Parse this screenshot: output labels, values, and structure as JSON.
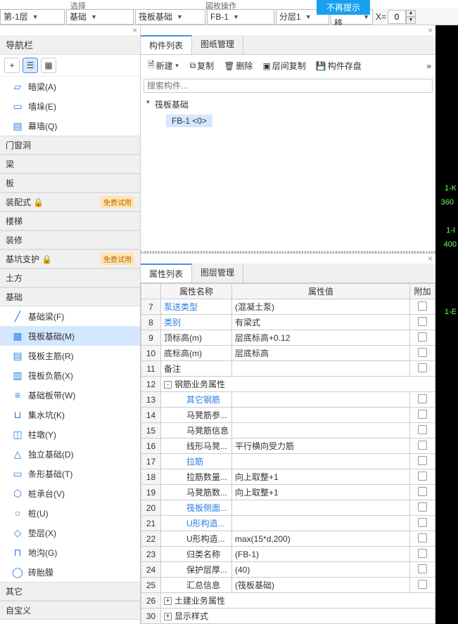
{
  "banner": "不再提示",
  "topbar_labels": {
    "l1": "选择",
    "l2": "図枚操作"
  },
  "toolbar": {
    "floor": "第-1层",
    "cat": "基础",
    "subcat": "筏板基础",
    "item": "FB-1",
    "layer": "分层1",
    "offset": "不偏移",
    "xlabel": "X=",
    "xval": "0"
  },
  "nav": {
    "title": "导航栏",
    "items_top": [
      {
        "icon": "▱",
        "label": "暗梁(A)"
      },
      {
        "icon": "▭",
        "label": "墙垛(E)"
      },
      {
        "icon": "▤",
        "label": "幕墙(Q)"
      }
    ],
    "sections": [
      {
        "title": "门窗洞"
      },
      {
        "title": "梁"
      },
      {
        "title": "板"
      },
      {
        "title": "装配式",
        "locked": true,
        "badge": "免费试用"
      },
      {
        "title": "楼梯"
      },
      {
        "title": "装修"
      },
      {
        "title": "基坑支护",
        "locked": true,
        "badge": "免费试用"
      },
      {
        "title": "土方"
      },
      {
        "title": "基础",
        "expanded": true,
        "items": [
          {
            "icon": "╱",
            "label": "基础梁(F)"
          },
          {
            "icon": "▦",
            "label": "筏板基础(M)",
            "active": true
          },
          {
            "icon": "▤",
            "label": "筏板主筋(R)"
          },
          {
            "icon": "▥",
            "label": "筏板负筋(X)"
          },
          {
            "icon": "≡",
            "label": "基础板带(W)"
          },
          {
            "icon": "⊔",
            "label": "集水坑(K)"
          },
          {
            "icon": "◫",
            "label": "柱墩(Y)"
          },
          {
            "icon": "△",
            "label": "独立基础(D)"
          },
          {
            "icon": "▭",
            "label": "条形基础(T)"
          },
          {
            "icon": "⬡",
            "label": "桩承台(V)"
          },
          {
            "icon": "○",
            "label": "桩(U)"
          },
          {
            "icon": "◇",
            "label": "垫层(X)"
          },
          {
            "icon": "⊓",
            "label": "地沟(G)"
          },
          {
            "icon": "◯",
            "label": "砖胎膜"
          }
        ]
      },
      {
        "title": "其它"
      },
      {
        "title": "自宝义"
      }
    ]
  },
  "comp": {
    "tabs": {
      "a": "构件列表",
      "b": "图纸管理"
    },
    "tools": {
      "new": "新建",
      "copy": "复制",
      "del": "删除",
      "layercopy": "层间复制",
      "save": "构件存盘"
    },
    "search_ph": "搜索构件...",
    "tree": {
      "root": "筏板基础",
      "leaf": "FB-1  <0>"
    }
  },
  "prop": {
    "tabs": {
      "a": "属性列表",
      "b": "图层管理"
    },
    "headers": {
      "name": "属性名称",
      "val": "属性值",
      "att": "附加"
    },
    "rows": [
      {
        "n": "7",
        "name": "泵送类型",
        "val": "(混凝土泵)",
        "link": true,
        "att": true
      },
      {
        "n": "8",
        "name": "类别",
        "val": "有梁式",
        "link": true,
        "att": true
      },
      {
        "n": "9",
        "name": "顶标高(m)",
        "val": "层底标高+0.12",
        "att": true
      },
      {
        "n": "10",
        "name": "底标高(m)",
        "val": "层底标高",
        "att": true
      },
      {
        "n": "11",
        "name": "备注",
        "val": "",
        "att": true
      },
      {
        "n": "12",
        "group": true,
        "exp": "-",
        "name": "钢筋业务属性"
      },
      {
        "n": "13",
        "name": "其它钢筋",
        "val": "",
        "indent": 2,
        "link": true,
        "att": true
      },
      {
        "n": "14",
        "name": "马凳筋参...",
        "val": "",
        "indent": 2,
        "att": true
      },
      {
        "n": "15",
        "name": "马凳筋信息",
        "val": "",
        "indent": 2,
        "att": true
      },
      {
        "n": "16",
        "name": "线形马凳...",
        "val": "平行横向受力筋",
        "indent": 2,
        "att": true
      },
      {
        "n": "17",
        "name": "拉筋",
        "val": "",
        "indent": 2,
        "link": true,
        "att": true
      },
      {
        "n": "18",
        "name": "拉筋数量...",
        "val": "向上取整+1",
        "indent": 2,
        "att": true
      },
      {
        "n": "19",
        "name": "马凳筋数...",
        "val": "向上取整+1",
        "indent": 2,
        "att": true
      },
      {
        "n": "20",
        "name": "筏板侧面...",
        "val": "",
        "indent": 2,
        "link": true,
        "att": true,
        "hl": true
      },
      {
        "n": "21",
        "name": "U形构造...",
        "val": "",
        "indent": 2,
        "link": true,
        "att": true
      },
      {
        "n": "22",
        "name": "U形构造...",
        "val": "max(15*d,200)",
        "indent": 2,
        "att": true
      },
      {
        "n": "23",
        "name": "归类名称",
        "val": "(FB-1)",
        "indent": 2,
        "att": true
      },
      {
        "n": "24",
        "name": "保护层厚...",
        "val": "(40)",
        "indent": 2,
        "att": true
      },
      {
        "n": "25",
        "name": "汇总信息",
        "val": "(筏板基础)",
        "indent": 2,
        "att": true
      },
      {
        "n": "26",
        "group": true,
        "exp": "+",
        "name": "土建业务属性"
      },
      {
        "n": "30",
        "group": true,
        "exp": "+",
        "name": "显示样式"
      }
    ]
  },
  "canvas": {
    "t1": "1-K",
    "t2": "360",
    "t3": "1-I",
    "t4": "400",
    "t5": "1-E"
  }
}
